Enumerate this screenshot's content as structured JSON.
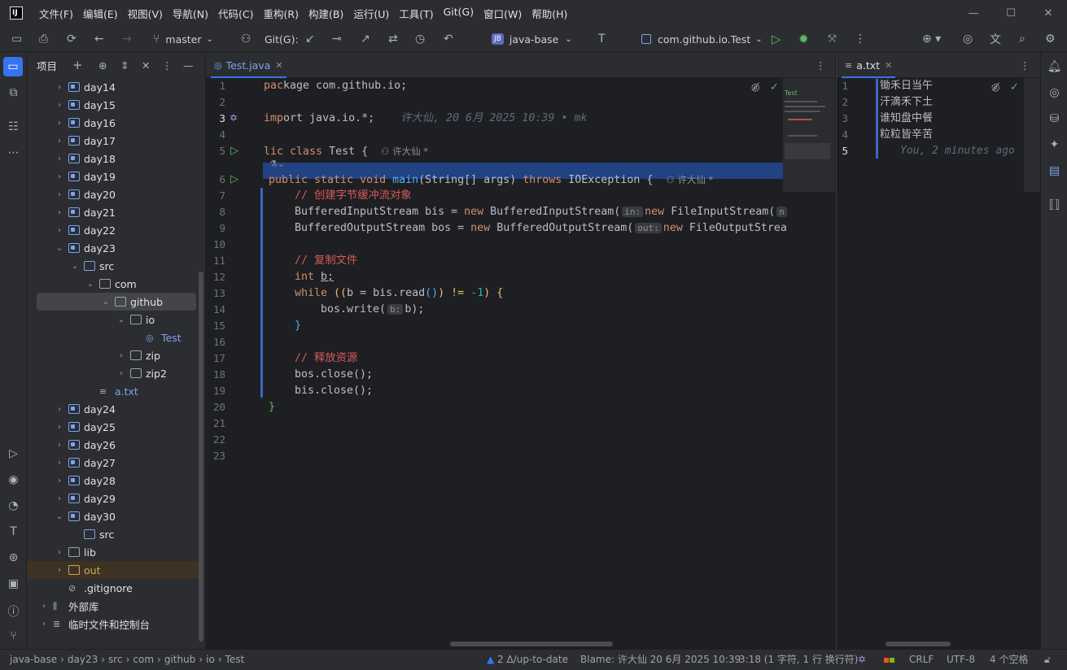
{
  "menu": [
    "文件(F)",
    "编辑(E)",
    "视图(V)",
    "导航(N)",
    "代码(C)",
    "重构(R)",
    "构建(B)",
    "运行(U)",
    "工具(T)",
    "Git(G)",
    "窗口(W)",
    "帮助(H)"
  ],
  "toolbar": {
    "branch": "master",
    "git_label": "Git(G):",
    "project_badge": "JB",
    "project": "java-base",
    "run_config": "com.github.io.Test"
  },
  "project_panel": {
    "title": "项目"
  },
  "tree": [
    {
      "label": "day14",
      "depth": 1,
      "chev": "›",
      "icon": "mod"
    },
    {
      "label": "day15",
      "depth": 1,
      "chev": "›",
      "icon": "mod"
    },
    {
      "label": "day16",
      "depth": 1,
      "chev": "›",
      "icon": "mod"
    },
    {
      "label": "day17",
      "depth": 1,
      "chev": "›",
      "icon": "mod"
    },
    {
      "label": "day18",
      "depth": 1,
      "chev": "›",
      "icon": "mod"
    },
    {
      "label": "day19",
      "depth": 1,
      "chev": "›",
      "icon": "mod"
    },
    {
      "label": "day20",
      "depth": 1,
      "chev": "›",
      "icon": "mod"
    },
    {
      "label": "day21",
      "depth": 1,
      "chev": "›",
      "icon": "mod"
    },
    {
      "label": "day22",
      "depth": 1,
      "chev": "›",
      "icon": "mod"
    },
    {
      "label": "day23",
      "depth": 1,
      "chev": "⌄",
      "icon": "mod"
    },
    {
      "label": "src",
      "depth": 2,
      "chev": "⌄",
      "icon": "src"
    },
    {
      "label": "com",
      "depth": 3,
      "chev": "⌄",
      "icon": "pkg"
    },
    {
      "label": "github",
      "depth": 4,
      "chev": "⌄",
      "icon": "pkg",
      "selected": true
    },
    {
      "label": "io",
      "depth": 5,
      "chev": "⌄",
      "icon": "pkg"
    },
    {
      "label": "Test",
      "depth": 6,
      "chev": "",
      "icon": "class"
    },
    {
      "label": "zip",
      "depth": 5,
      "chev": "›",
      "icon": "pkg"
    },
    {
      "label": "zip2",
      "depth": 5,
      "chev": "›",
      "icon": "pkg"
    },
    {
      "label": "a.txt",
      "depth": 3,
      "chev": "",
      "icon": "txt"
    },
    {
      "label": "day24",
      "depth": 1,
      "chev": "›",
      "icon": "mod"
    },
    {
      "label": "day25",
      "depth": 1,
      "chev": "›",
      "icon": "mod"
    },
    {
      "label": "day26",
      "depth": 1,
      "chev": "›",
      "icon": "mod"
    },
    {
      "label": "day27",
      "depth": 1,
      "chev": "›",
      "icon": "mod"
    },
    {
      "label": "day28",
      "depth": 1,
      "chev": "›",
      "icon": "mod"
    },
    {
      "label": "day29",
      "depth": 1,
      "chev": "›",
      "icon": "mod"
    },
    {
      "label": "day30",
      "depth": 1,
      "chev": "⌄",
      "icon": "mod"
    },
    {
      "label": "src",
      "depth": 2,
      "chev": "",
      "icon": "src"
    },
    {
      "label": "lib",
      "depth": 1,
      "chev": "›",
      "icon": "folder"
    },
    {
      "label": "out",
      "depth": 1,
      "chev": "›",
      "icon": "out",
      "highlight": true
    },
    {
      "label": ".gitignore",
      "depth": 1,
      "chev": "",
      "icon": "ignore"
    },
    {
      "label": "外部库",
      "depth": 0,
      "chev": "›",
      "icon": "lib"
    },
    {
      "label": "临时文件和控制台",
      "depth": 0,
      "chev": "›",
      "icon": "scratch"
    }
  ],
  "editor": {
    "tab": "Test.java",
    "blame_line3": "许大仙, 20 6月 2025 10:39 • mk",
    "author": "许大仙 *",
    "lines": [
      "1",
      "2",
      "3",
      "4",
      "5",
      "6",
      "7",
      "8",
      "9",
      "10",
      "11",
      "12",
      "13",
      "14",
      "15",
      "16",
      "17",
      "18",
      "19",
      "20",
      "21",
      "22",
      "23"
    ],
    "code": {
      "l1": "kage com.github.io;",
      "l3": "ort java.io.*;",
      "l5a": "lic class ",
      "l5b": "Test ",
      "l5c": "{",
      "l6a": "public static void ",
      "l6b": "main",
      "l6c": "(String[] args) ",
      "l6d": "throws ",
      "l6e": "IOException ",
      "l6f": "{",
      "l7": "// 创建字节缓冲流对象",
      "l8a": "BufferedInputStream bis = ",
      "l8b": "new ",
      "l8c": "BufferedInputStream(",
      "l8h": "in:",
      "l8d": "new ",
      "l8e": "FileInputStream(",
      "l8f": "n",
      "l9a": "BufferedOutputStream bos = ",
      "l9b": "new ",
      "l9c": "BufferedOutputStream(",
      "l9h": "out:",
      "l9d": "new ",
      "l9e": "FileOutputStrea",
      "l11": "// 复制文件",
      "l12a": "int ",
      "l12b": "b;",
      "l13a": "while ",
      "l13b": "((",
      "l13c": "b = bis.read",
      "l13d": "()",
      "l13e": ") != ",
      "l13f": "-1",
      "l13g": ") {",
      "l14a": "bos.write(",
      "l14h": "b:",
      "l14b": "b);",
      "l15": "}",
      "l17": "// 释放资源",
      "l18": "bos.close();",
      "l19": "bis.close();",
      "l20": "}"
    },
    "minimap_label": "Test"
  },
  "txt": {
    "tab": "a.txt",
    "lines": [
      "1",
      "2",
      "3",
      "4",
      "5"
    ],
    "content": [
      "锄禾日当午",
      "汗滴禾下土",
      "谁知盘中餐",
      "粒粒皆辛苦"
    ],
    "blame": "You, 2 minutes ago"
  },
  "status": {
    "crumbs": [
      "java-base",
      "day23",
      "src",
      "com",
      "github",
      "io",
      "Test"
    ],
    "vcs": "2 Δ/up-to-date",
    "blame": "Blame: 许大仙 20 6月 2025 10:39",
    "pos": "3:18 (1 字符, 1 行 换行符)",
    "eol": "CRLF",
    "enc": "UTF-8",
    "indent": "4 个空格"
  }
}
